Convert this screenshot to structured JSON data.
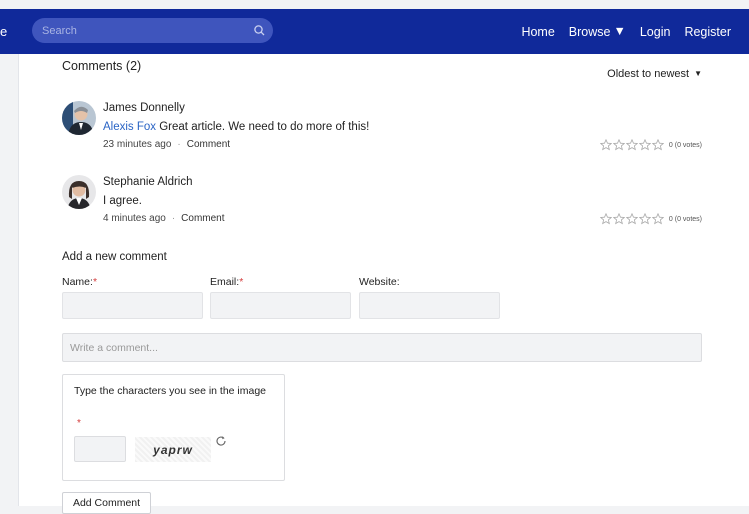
{
  "nav": {
    "brand_fragment": "e",
    "search_placeholder": "Search",
    "links": [
      {
        "label": "Home"
      },
      {
        "label": "Browse"
      },
      {
        "label": "Login"
      },
      {
        "label": "Register"
      }
    ]
  },
  "comments_section": {
    "heading": "Comments (2)",
    "sort_label": "Oldest to newest",
    "comments": [
      {
        "author": "James Donnelly",
        "mention": "Alexis Fox",
        "text": " Great article. We need to do more of this!",
        "time": "23 minutes ago",
        "reply_label": "Comment",
        "votes_label": "0 (0 votes)"
      },
      {
        "author": "Stephanie Aldrich",
        "mention": "",
        "text": "I agree.",
        "time": "4 minutes ago",
        "reply_label": "Comment",
        "votes_label": "0 (0 votes)"
      }
    ]
  },
  "form": {
    "title": "Add a new comment",
    "name_label": "Name:",
    "email_label": "Email:",
    "website_label": "Website:",
    "required_mark": "*",
    "comment_placeholder": "Write a comment...",
    "captcha_prompt": "Type the characters you see in the image",
    "captcha_text": "yaprw",
    "submit_label": "Add Comment"
  },
  "colors": {
    "nav_bg": "#10299a",
    "link": "#2a64c5",
    "required": "#d43c3c"
  }
}
